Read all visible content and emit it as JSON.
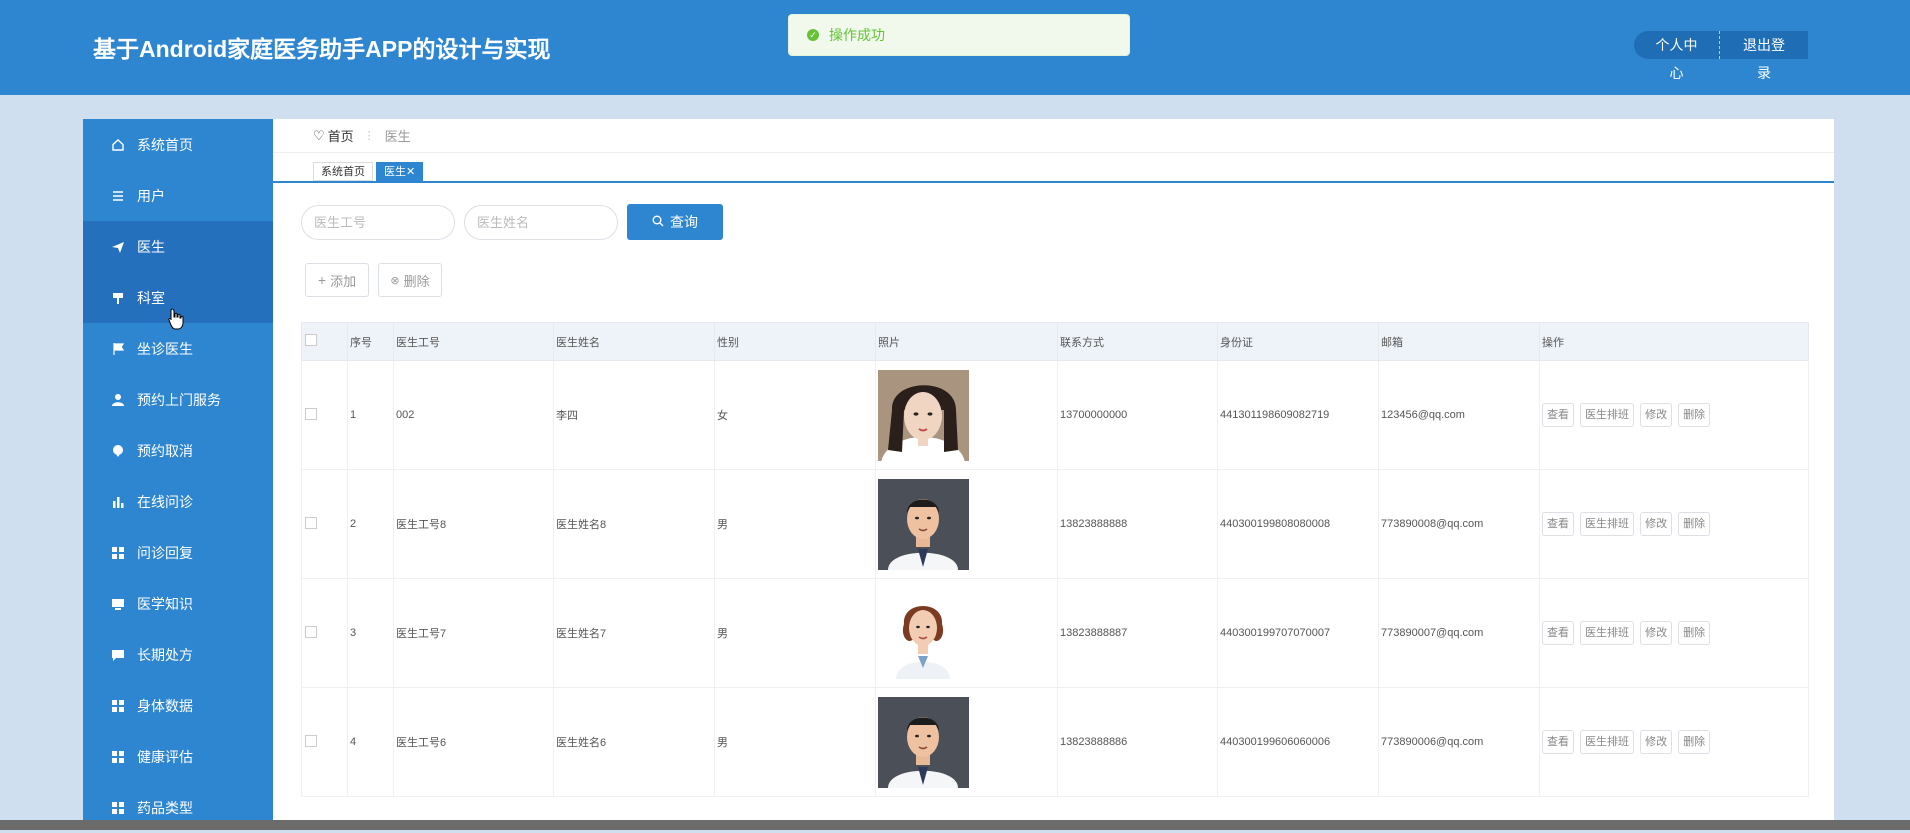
{
  "app": {
    "title": "基于Android家庭医务助手APP的设计与实现"
  },
  "toast": {
    "text": "操作成功",
    "color": "#67c23a"
  },
  "header": {
    "profile_label": "个人中心",
    "logout_label": "退出登录"
  },
  "sidebar": {
    "items": [
      {
        "label": "系统首页",
        "icon": "home-icon"
      },
      {
        "label": "用户",
        "icon": "list-icon"
      },
      {
        "label": "医生",
        "icon": "send-icon"
      },
      {
        "label": "科室",
        "icon": "brush-icon"
      },
      {
        "label": "坐诊医生",
        "icon": "flag-icon"
      },
      {
        "label": "预约上门服务",
        "icon": "user-icon"
      },
      {
        "label": "预约取消",
        "icon": "pin-icon"
      },
      {
        "label": "在线问诊",
        "icon": "bar-chart-icon"
      },
      {
        "label": "问诊回复",
        "icon": "grid-icon"
      },
      {
        "label": "医学知识",
        "icon": "monitor-icon"
      },
      {
        "label": "长期处方",
        "icon": "chat-icon"
      },
      {
        "label": "身体数据",
        "icon": "grid-icon"
      },
      {
        "label": "健康评估",
        "icon": "grid-icon"
      },
      {
        "label": "药品类型",
        "icon": "grid-icon"
      }
    ]
  },
  "breadcrumb": {
    "home": "首页",
    "separator": "⋮",
    "current": "医生"
  },
  "tags": {
    "home": "系统首页",
    "current": "医生✕"
  },
  "search": {
    "doctor_no_placeholder": "医生工号",
    "doctor_name_placeholder": "医生姓名",
    "button_label": "查询"
  },
  "toolbar": {
    "add_label": "添加",
    "delete_label": "删除"
  },
  "table": {
    "headers": [
      "序号",
      "医生工号",
      "医生姓名",
      "性别",
      "照片",
      "联系方式",
      "身份证",
      "邮箱",
      "操作"
    ],
    "rows": [
      {
        "index": "1",
        "no": "002",
        "name": "李四",
        "gender": "女",
        "phone": "13700000000",
        "id_card": "441301198609082719",
        "email": "123456@qq.com",
        "photo": "female-portrait"
      },
      {
        "index": "2",
        "no": "医生工号8",
        "name": "医生姓名8",
        "gender": "男",
        "phone": "13823888888",
        "id_card": "440300199808080008",
        "email": "773890008@qq.com",
        "photo": "male-doctor-portrait"
      },
      {
        "index": "3",
        "no": "医生工号7",
        "name": "医生姓名7",
        "gender": "男",
        "phone": "13823888887",
        "id_card": "440300199707070007",
        "email": "773890007@qq.com",
        "photo": "female-doctor-portrait"
      },
      {
        "index": "4",
        "no": "医生工号6",
        "name": "医生姓名6",
        "gender": "男",
        "phone": "13823888886",
        "id_card": "440300199606060006",
        "email": "773890006@qq.com",
        "photo": "male-doctor-portrait"
      }
    ],
    "actions": {
      "view": "查看",
      "schedule": "医生排班",
      "edit": "修改",
      "delete": "删除"
    }
  },
  "colors": {
    "primary": "#2e86d1",
    "sidebar_active": "#2470bd",
    "background": "#cfdff0"
  }
}
